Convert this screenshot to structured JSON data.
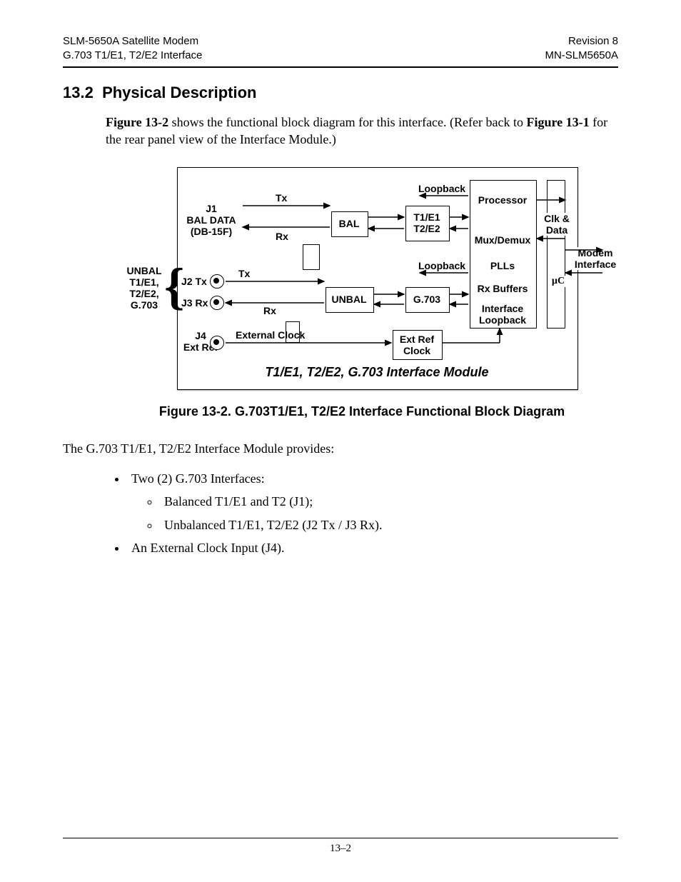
{
  "header": {
    "left1": "SLM-5650A Satellite Modem",
    "left2": "G.703 T1/E1, T2/E2 Interface",
    "right1": "Revision 8",
    "right2": "MN-SLM5650A"
  },
  "section": {
    "number": "13.2",
    "title": "Physical Description"
  },
  "intro": {
    "ref1": "Figure 13-2",
    "text1": " shows the functional block diagram for this interface. (Refer back to ",
    "ref2": "Figure 13-1",
    "text2": " for the rear panel view of the Interface Module.)"
  },
  "diagram": {
    "unbal_side": "UNBAL\nT1/E1,\nT2/E2,\nG.703",
    "j1": "J1\nBAL DATA\n(DB-15F)",
    "j2": "J2 Tx",
    "j3": "J3 Rx",
    "j4": "J4\nExt Ref",
    "tx": "Tx",
    "rx": "Rx",
    "ext_clock": "External Clock",
    "bal": "BAL",
    "unbal_box": "UNBAL",
    "extref": "Ext Ref\nClock",
    "t1e1": "T1/E1\nT2/E2",
    "g703": "G.703",
    "loopback": "Loopback",
    "processor": "Processor",
    "muxdemux": "Mux/Demux",
    "plls": "PLLs",
    "rxbuf": "Rx Buffers",
    "ifloop": "Interface\nLoopback",
    "uc": "µC",
    "clkdata": "Clk &\nData",
    "modemif": "Modem\nInterface",
    "module_title": "T1/E1, T2/E2, G.703 Interface Module"
  },
  "fig_caption": "Figure 13-2. G.703T1/E1, T2/E2 Interface Functional Block Diagram",
  "body2": "The G.703 T1/E1, T2/E2 Interface Module provides:",
  "bullets": {
    "b1": "Two (2) G.703 Interfaces:",
    "s1": "Balanced T1/E1 and T2 (J1);",
    "s2": "Unbalanced T1/E1, T2/E2 (J2 Tx / J3 Rx).",
    "b2": "An External Clock Input (J4)."
  },
  "footer": "13–2"
}
